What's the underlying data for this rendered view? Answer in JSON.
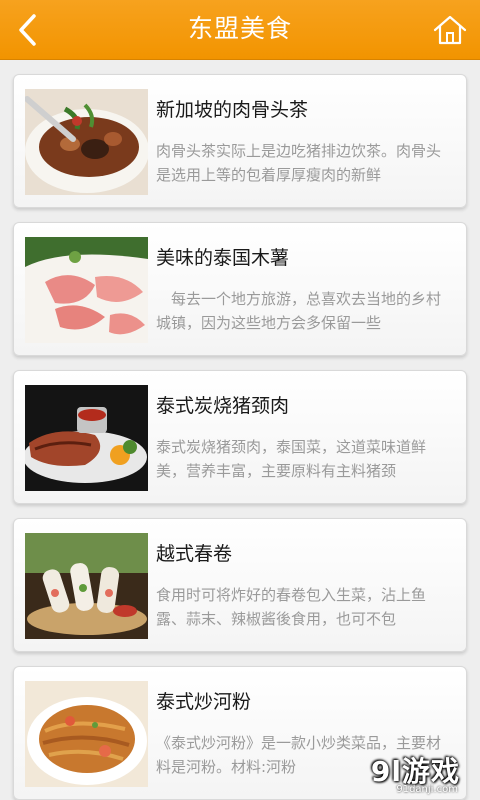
{
  "header": {
    "title": "东盟美食",
    "back_icon": "chevron-left-icon",
    "home_icon": "home-icon"
  },
  "colors": {
    "header_bg": "#f29400",
    "title_text": "#1a1a1a",
    "desc_text": "#9a9a9a"
  },
  "items": [
    {
      "title": "新加坡的肉骨头茶",
      "desc": "肉骨头茶实际上是边吃猪排边饮茶。肉骨头是选用上等的包着厚厚瘦肉的新鲜"
    },
    {
      "title": "美味的泰国木薯",
      "desc": "　每去一个地方旅游，总喜欢去当地的乡村城镇，因为这些地方会多保留一些"
    },
    {
      "title": "泰式炭烧猪颈肉",
      "desc": "泰式炭烧猪颈肉，泰国菜，这道菜味道鲜美，营养丰富，主要原料有主料猪颈"
    },
    {
      "title": "越式春卷",
      "desc": "食用时可将炸好的春卷包入生菜，沾上鱼露、蒜末、辣椒酱後食用，也可不包"
    },
    {
      "title": "泰式炒河粉",
      "desc": "《泰式炒河粉》是一款小炒类菜品，主要材料是河粉。材料:河粉"
    }
  ],
  "watermark": {
    "logo": "9l游戏",
    "url": "91danji.com"
  }
}
